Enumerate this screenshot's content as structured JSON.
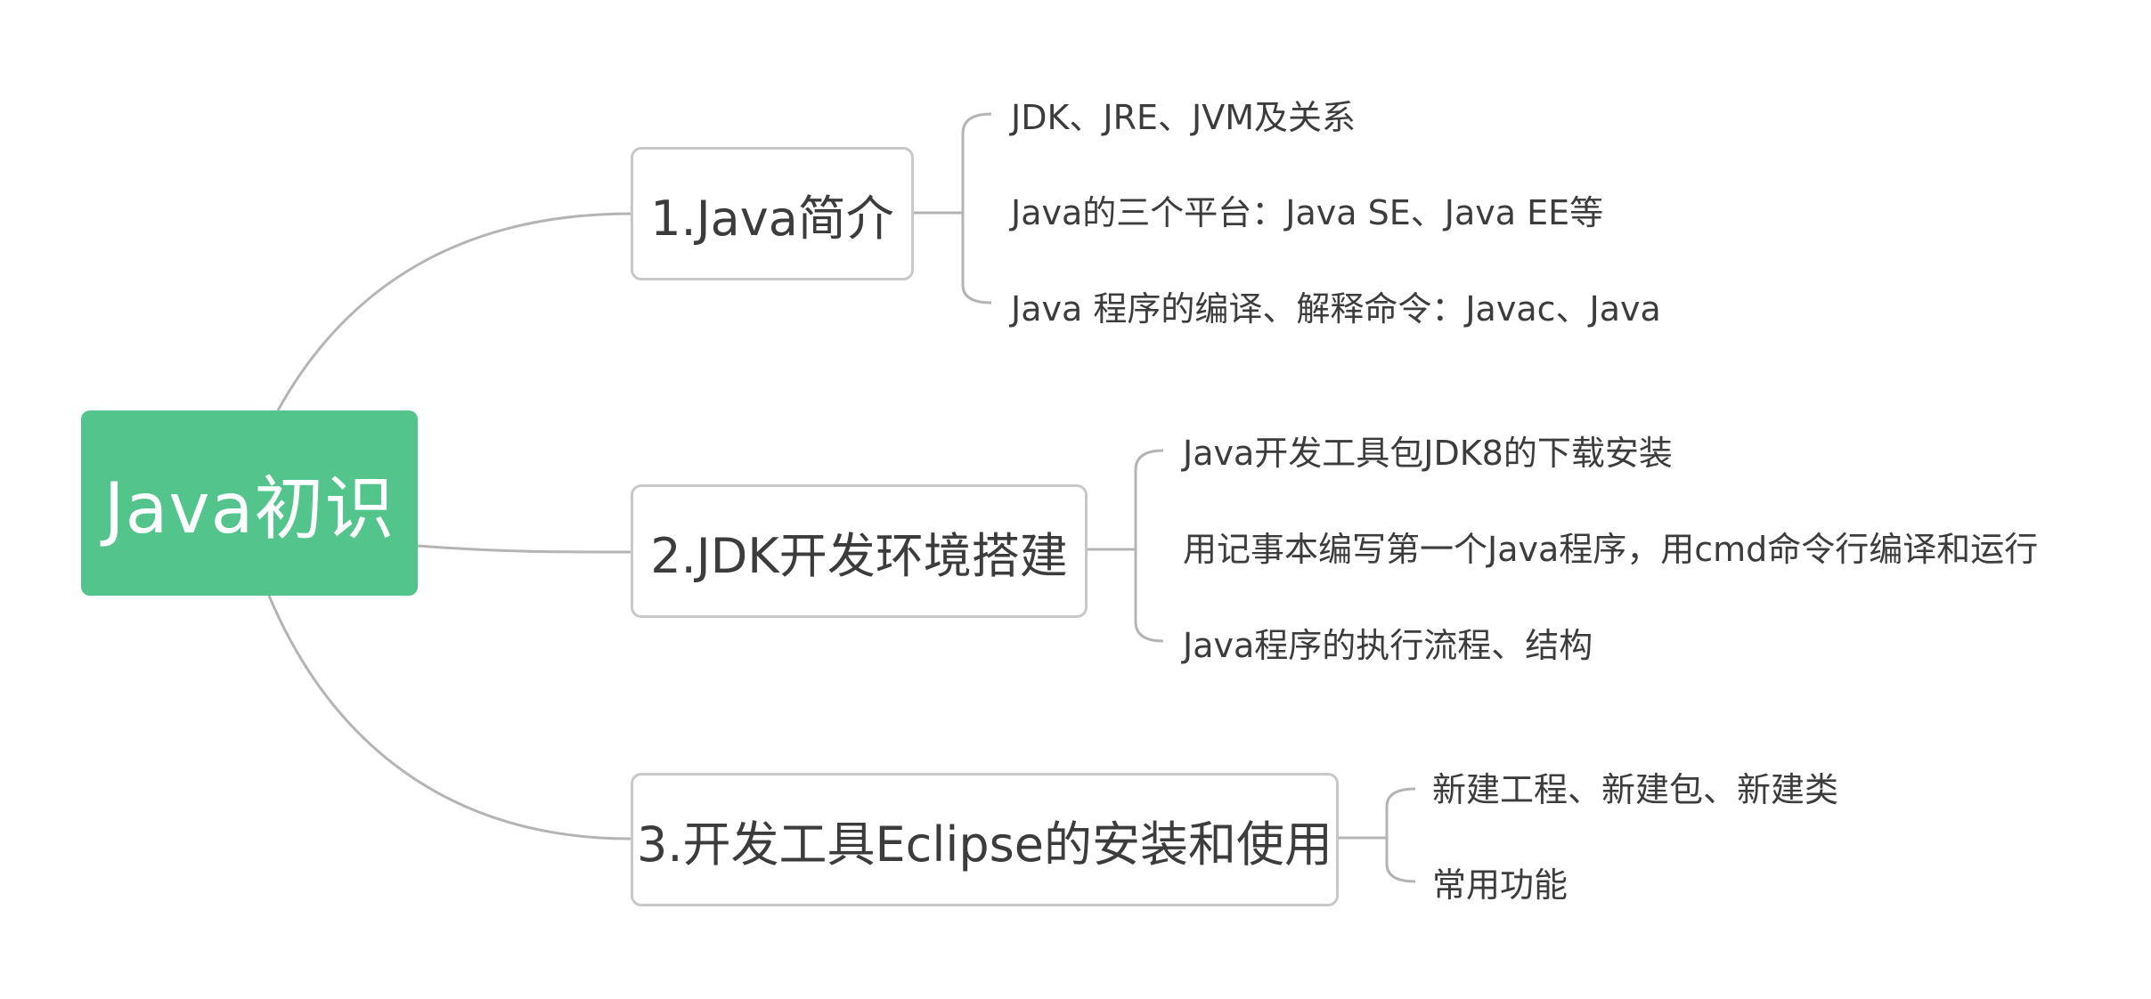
{
  "root": {
    "label": "Java初识"
  },
  "branches": [
    {
      "label": "1.Java简介",
      "children": [
        "JDK、JRE、JVM及关系",
        "Java的三个平台：Java SE、Java EE等",
        "Java 程序的编译、解释命令：Javac、Java"
      ]
    },
    {
      "label": "2.JDK开发环境搭建",
      "children": [
        "Java开发工具包JDK8的下载安装",
        "用记事本编写第一个Java程序，用cmd命令行编译和运行",
        "Java程序的执行流程、结构"
      ]
    },
    {
      "label": "3.开发工具Eclipse的安装和使用",
      "children": [
        "新建工程、新建包、新建类",
        "常用功能"
      ]
    }
  ],
  "colors": {
    "root_fill": "#52c48c",
    "root_text": "#ffffff",
    "connector": "#b4b4b4",
    "text": "#3c3c3c"
  }
}
